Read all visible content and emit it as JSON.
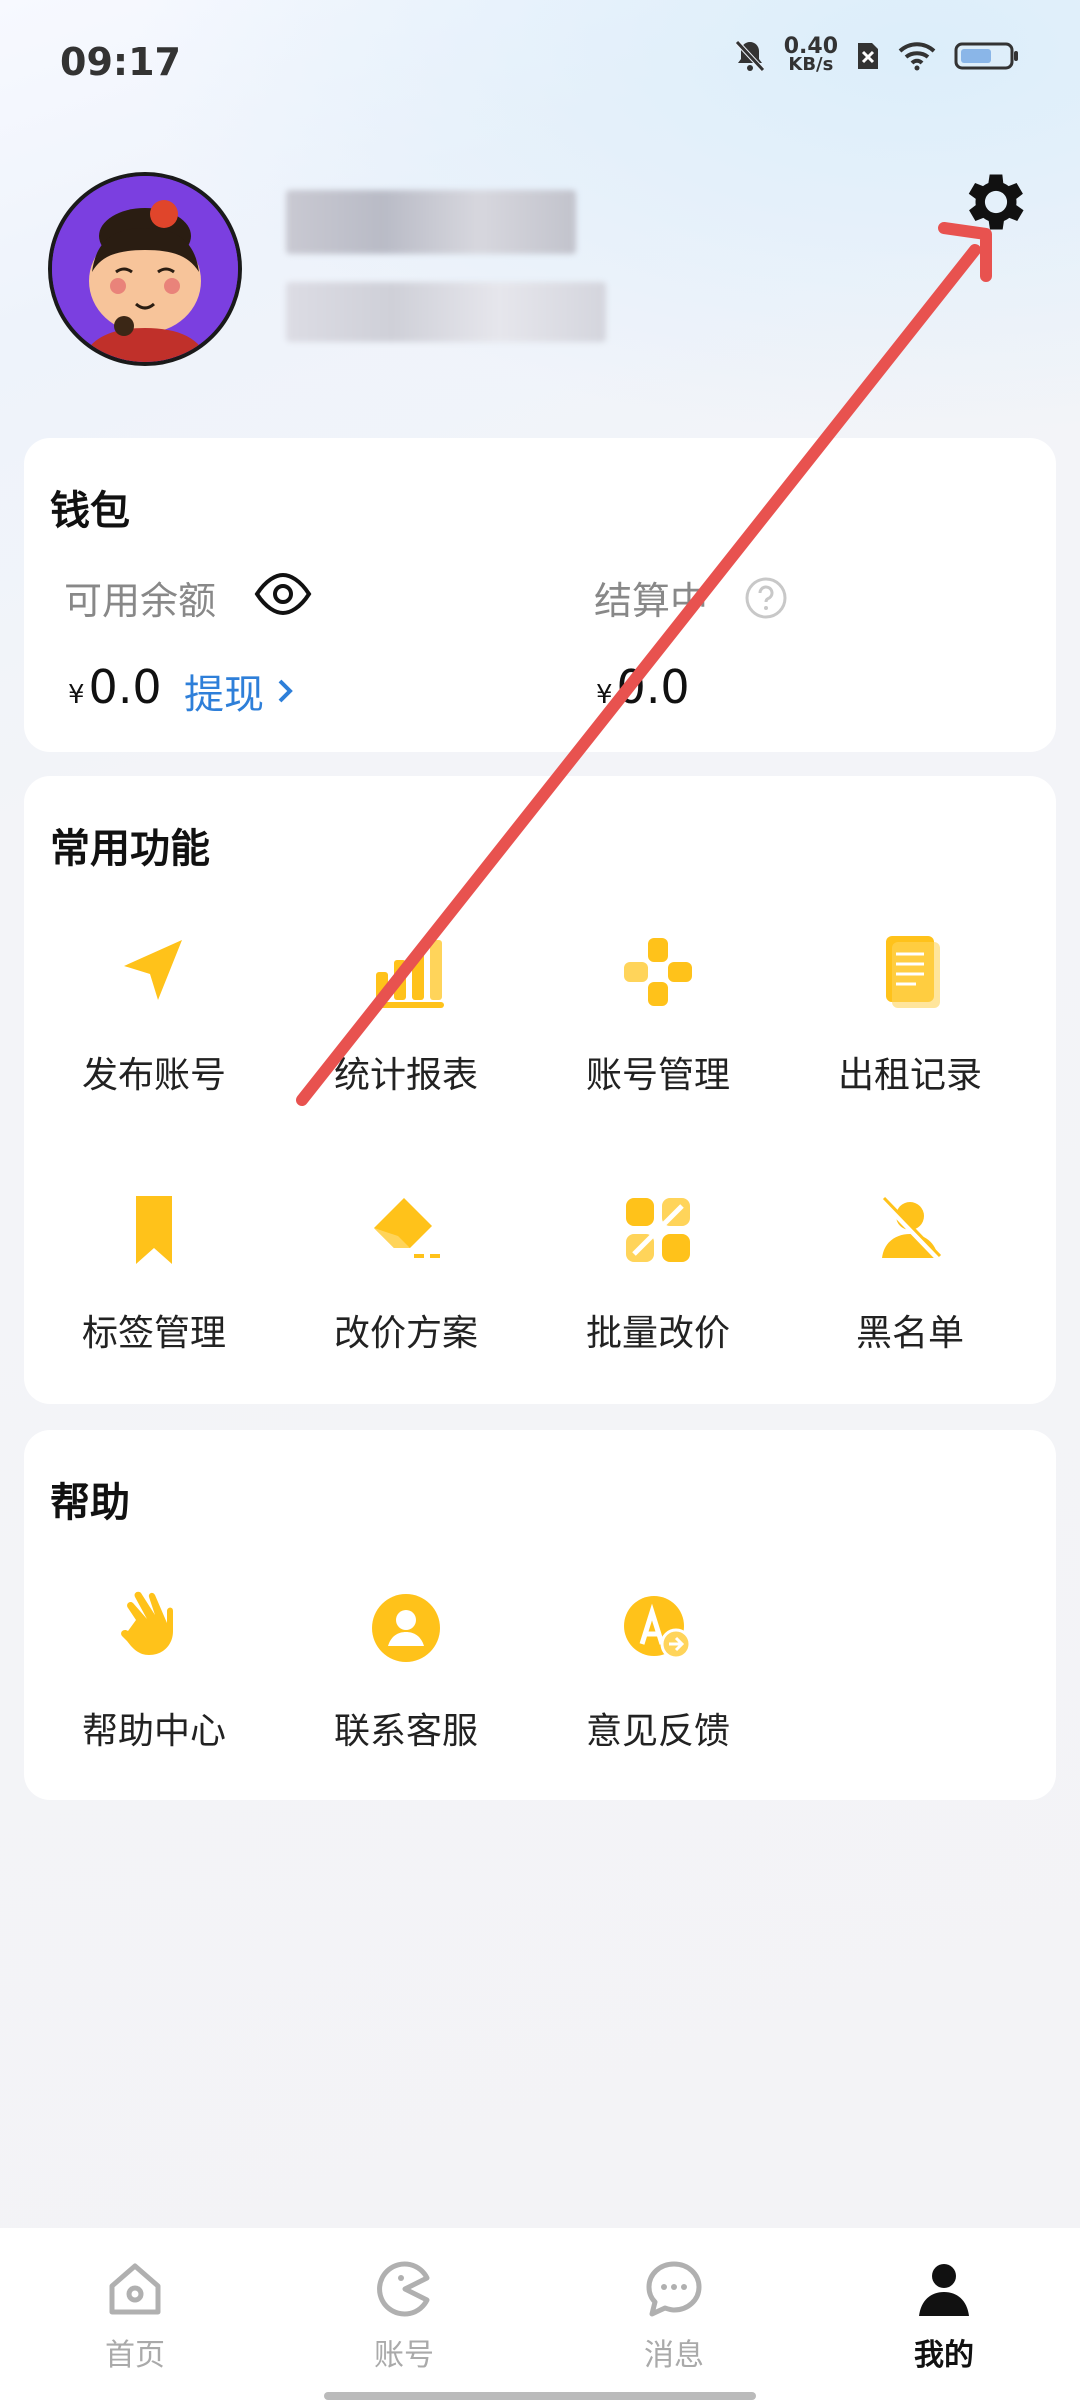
{
  "status_bar": {
    "time": "09:17",
    "net_speed_value": "0.40",
    "net_speed_unit": "KB/s",
    "icons": [
      "mute-bell-icon",
      "sim-blocked-icon",
      "wifi-icon",
      "battery-icon"
    ]
  },
  "profile": {
    "avatar": "cartoon-avatar",
    "settings_icon": "gear-icon"
  },
  "wallet": {
    "title": "钱包",
    "available_label": "可用余额",
    "available_value": "0.0",
    "currency": "¥",
    "withdraw_label": "提现",
    "settling_label": "结算中",
    "settling_value": "0.0"
  },
  "features": {
    "title": "常用功能",
    "items": [
      {
        "label": "发布账号",
        "icon": "send-arrow-icon"
      },
      {
        "label": "统计报表",
        "icon": "bar-chart-icon"
      },
      {
        "label": "账号管理",
        "icon": "gamepad-icon"
      },
      {
        "label": "出租记录",
        "icon": "document-icon"
      },
      {
        "label": "标签管理",
        "icon": "bookmark-icon"
      },
      {
        "label": "改价方案",
        "icon": "eraser-icon"
      },
      {
        "label": "批量改价",
        "icon": "tools-icon"
      },
      {
        "label": "黑名单",
        "icon": "blocked-user-icon"
      }
    ]
  },
  "help": {
    "title": "帮助",
    "items": [
      {
        "label": "帮助中心",
        "icon": "waving-hand-icon"
      },
      {
        "label": "联系客服",
        "icon": "user-circle-icon"
      },
      {
        "label": "意见反馈",
        "icon": "feedback-icon"
      }
    ]
  },
  "tabbar": {
    "items": [
      {
        "label": "首页",
        "icon": "home-icon"
      },
      {
        "label": "账号",
        "icon": "pacman-icon"
      },
      {
        "label": "消息",
        "icon": "chat-icon"
      },
      {
        "label": "我的",
        "icon": "person-icon"
      }
    ],
    "active": "我的"
  },
  "colors": {
    "accent_yellow": "#ffc21a",
    "link_blue": "#2e7fd9",
    "annotation_red": "#e8524f"
  }
}
